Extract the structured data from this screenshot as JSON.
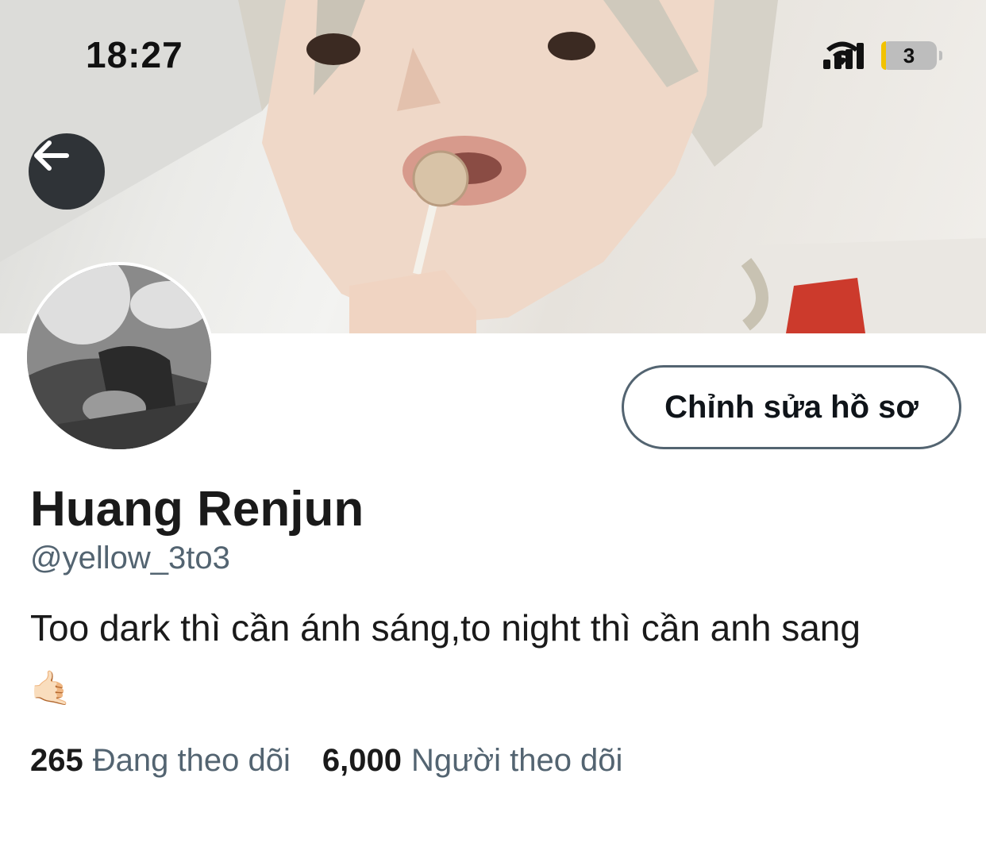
{
  "status_bar": {
    "time": "18:27",
    "battery_level": "3",
    "icons": [
      "signal-icon",
      "wifi-icon",
      "battery-icon"
    ]
  },
  "banner": {
    "image": "profile banner photo"
  },
  "back_button": {
    "icon": "arrow-left-icon"
  },
  "profile": {
    "avatar": "profile avatar photo",
    "edit_button_label": "Chỉnh sửa hồ sơ",
    "display_name": "Huang Renjun",
    "handle": "@yellow_3to3",
    "bio": "Too dark thì cần ánh sáng,to night thì cần anh sang",
    "bio_emoji": "🤙🏻"
  },
  "stats": {
    "following_count": "265",
    "following_label": "Đang theo dõi",
    "followers_count": "6,000",
    "followers_label": "Người theo dõi"
  },
  "colors": {
    "text_primary": "#0f1419",
    "text_secondary": "#536471",
    "back_button_bg": "#2f3337",
    "battery_accent": "#f2c200"
  }
}
